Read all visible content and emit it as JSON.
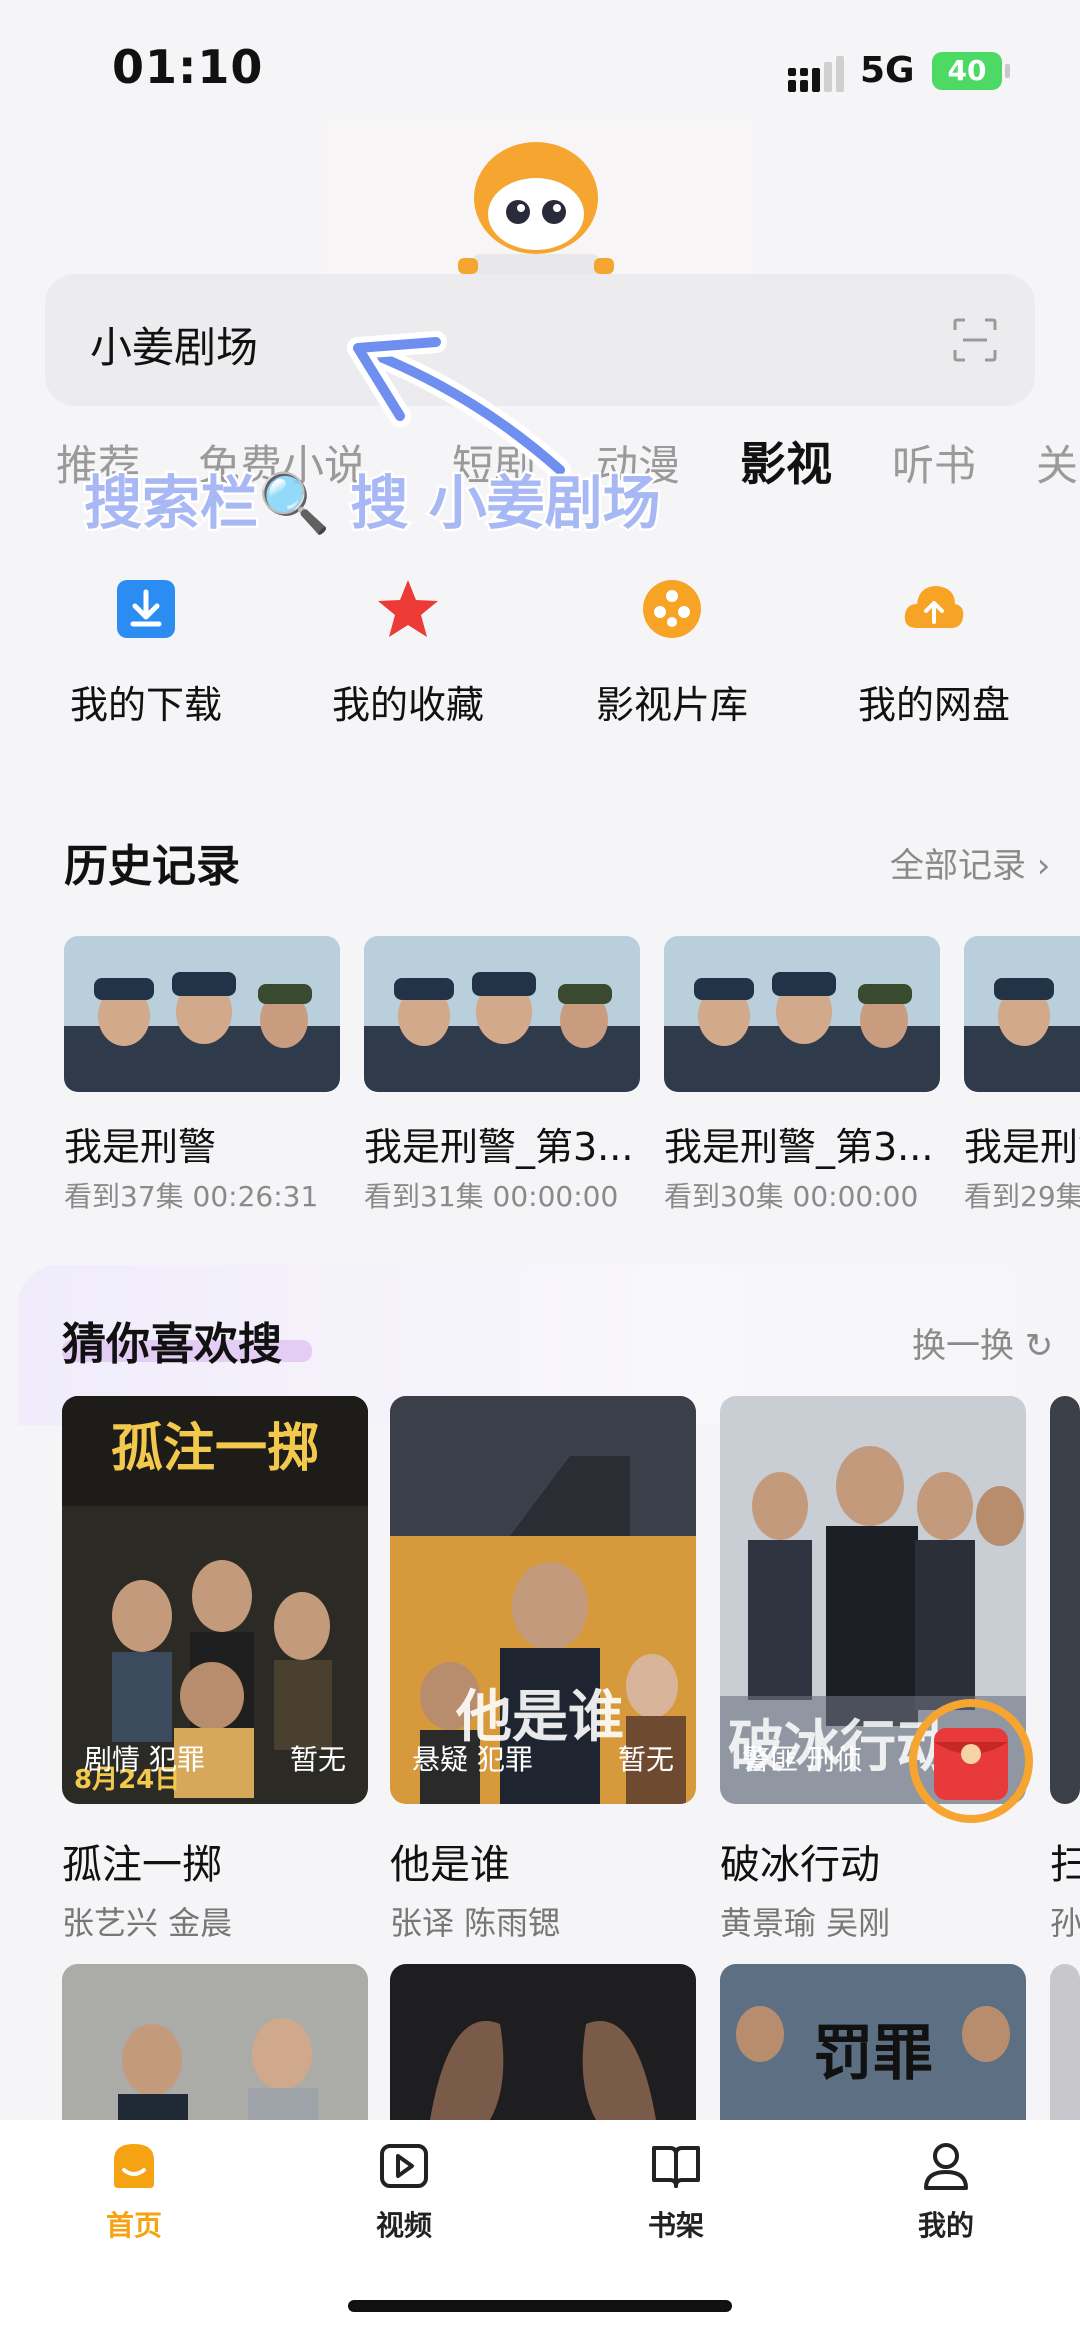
{
  "status_bar": {
    "time": "01:10",
    "network": "5G",
    "battery": "40"
  },
  "search": {
    "text": "小姜剧场"
  },
  "tabs": [
    "推荐",
    "免费小说",
    "短剧",
    "动漫",
    "影视",
    "听书",
    "关"
  ],
  "active_tab": "影视",
  "annotation": {
    "text": "搜索栏🔍 搜 小姜剧场"
  },
  "quick_actions": [
    {
      "label": "我的下载",
      "icon": "download-icon"
    },
    {
      "label": "我的收藏",
      "icon": "star-icon"
    },
    {
      "label": "影视片库",
      "icon": "film-reel-icon"
    },
    {
      "label": "我的网盘",
      "icon": "cloud-upload-icon"
    }
  ],
  "history": {
    "title": "历史记录",
    "more": "全部记录",
    "items": [
      {
        "title": "我是刑警",
        "progress": "看到37集 00:26:31"
      },
      {
        "title": "我是刑警_第3...",
        "progress": "看到31集 00:00:00"
      },
      {
        "title": "我是刑警_第3...",
        "progress": "看到30集 00:00:00"
      },
      {
        "title": "我是刑警",
        "progress": "看到29集"
      }
    ]
  },
  "recommend": {
    "title": "猜你喜欢搜",
    "refresh": "换一换",
    "items": [
      {
        "title": "孤注一掷",
        "tags": "剧情 犯罪",
        "score": "暂无",
        "cast": "张艺兴 金晨",
        "poster_text": "孤注一掷",
        "date_text": "8月24日"
      },
      {
        "title": "他是谁",
        "tags": "悬疑 犯罪",
        "score": "暂无",
        "cast": "张译 陈雨锶",
        "poster_text": "他是谁"
      },
      {
        "title": "破冰行动",
        "tags": "警匪 刑侦",
        "score": "",
        "cast": "黄景瑜 吴刚",
        "poster_text": "破冰行动"
      },
      {
        "title": "扫",
        "tags": "",
        "score": "",
        "cast": "孙",
        "poster_text": ""
      }
    ],
    "row2_poster_text": "罚罪"
  },
  "bottom_tabs": [
    {
      "label": "首页",
      "icon": "home-icon",
      "active": true
    },
    {
      "label": "视频",
      "icon": "video-icon",
      "active": false
    },
    {
      "label": "书架",
      "icon": "bookshelf-icon",
      "active": false
    },
    {
      "label": "我的",
      "icon": "profile-icon",
      "active": false
    }
  ],
  "colors": {
    "accent": "#f5a312",
    "annotation": "#a7b8f4",
    "background": "#f5f5f7"
  }
}
